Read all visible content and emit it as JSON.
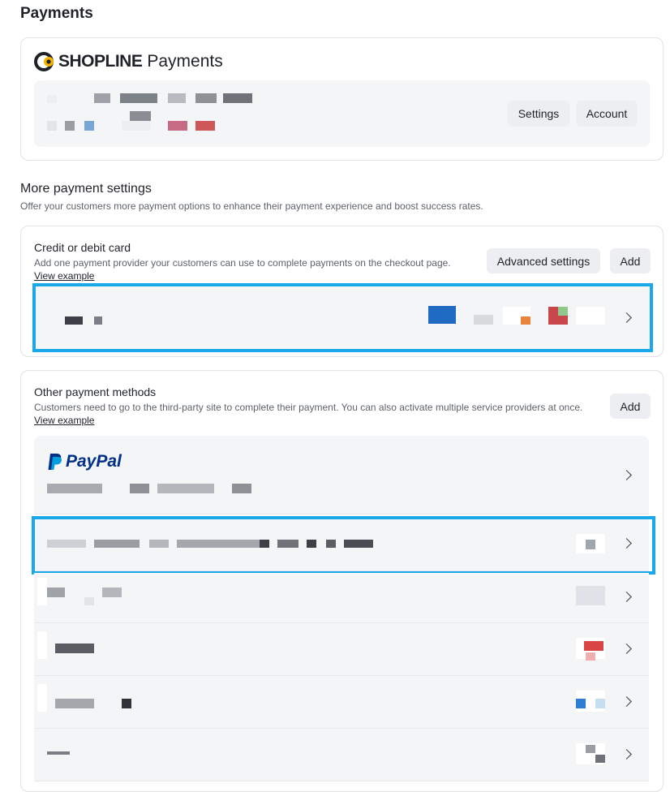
{
  "page": {
    "title": "Payments"
  },
  "shopline": {
    "logo_text": "SHOPLINE",
    "logo_suffix": "Payments",
    "settings_label": "Settings",
    "account_label": "Account"
  },
  "more_settings": {
    "title": "More payment settings",
    "description": "Offer your customers more payment options to enhance their payment experience and boost success rates."
  },
  "card_section": {
    "title": "Credit or debit card",
    "description": "Add one payment provider your customers can use to complete payments on the checkout page.",
    "view_example": "View example",
    "advanced_label": "Advanced settings",
    "add_label": "Add"
  },
  "other_section": {
    "title": "Other payment methods",
    "description": "Customers need to go to the third-party site to complete their payment. You can also activate multiple service providers at once.",
    "view_example": "View example",
    "add_label": "Add",
    "paypal_label": "PayPal"
  },
  "colors": {
    "highlight": "#1aa8e8",
    "paypal_dark": "#003087",
    "paypal_light": "#009cde",
    "logo_accent": "#f5b400"
  }
}
